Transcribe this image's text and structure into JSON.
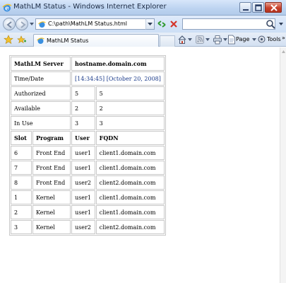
{
  "window": {
    "title": "MathLM Status - Windows Internet Explorer"
  },
  "address_bar": {
    "url": "C:\\path\\MathLM Status.html"
  },
  "tab": {
    "label": "MathLM Status"
  },
  "command_bar": {
    "page_label": "Page",
    "tools_label": "Tools",
    "more_label": "»"
  },
  "status_table": {
    "header": [
      "MathLM Server",
      "hostname.domain.com"
    ],
    "info_rows": [
      {
        "label": "Time/Date",
        "value": "[14:34:45] [October 20, 2008]"
      },
      {
        "label": "Authorized",
        "value": "5",
        "value2": "5"
      },
      {
        "label": "Available",
        "value": "2",
        "value2": "2"
      },
      {
        "label": "In Use",
        "value": "3",
        "value2": "3"
      }
    ],
    "columns": [
      "Slot",
      "Program",
      "User",
      "FQDN"
    ],
    "rows": [
      [
        "6",
        "Front End",
        "user1",
        "client1.domain.com"
      ],
      [
        "7",
        "Front End",
        "user1",
        "client1.domain.com"
      ],
      [
        "8",
        "Front End",
        "user2",
        "client2.domain.com"
      ],
      [
        "1",
        "Kernel",
        "user1",
        "client1.domain.com"
      ],
      [
        "2",
        "Kernel",
        "user1",
        "client1.domain.com"
      ],
      [
        "3",
        "Kernel",
        "user2",
        "client2.domain.com"
      ]
    ]
  },
  "colors": {
    "titlebar": "#bcd3f0",
    "close_button": "#c8402b",
    "table_border": "#c8c8c8",
    "time_text": "#1b3b8a"
  },
  "icons": [
    "ie-icon",
    "minimize-icon",
    "maximize-icon",
    "close-icon",
    "back-icon",
    "forward-icon",
    "refresh-icon",
    "stop-icon",
    "search-icon",
    "favorites-star-icon",
    "add-favorites-icon",
    "home-icon",
    "feeds-icon",
    "print-icon",
    "page-icon",
    "tools-icon"
  ]
}
